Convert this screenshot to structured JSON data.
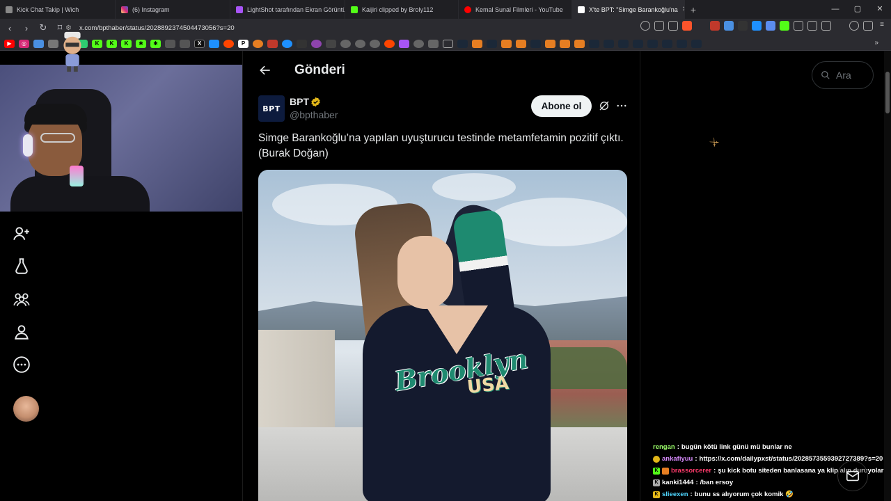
{
  "browser": {
    "tabs": [
      {
        "title": "Kick Chat Takip | Wich",
        "favicon_color": "#888888",
        "active": false
      },
      {
        "title": "(6) Instagram",
        "favicon_color": "#d6249f",
        "active": false
      },
      {
        "title": "LightShot tarafından Ekran Görüntüs",
        "favicon_color": "#a855f7",
        "active": false
      },
      {
        "title": "Kaijiri clipped by Broly112",
        "favicon_color": "#53fc18",
        "active": false
      },
      {
        "title": "Kemal Sunal Filmleri - YouTube",
        "favicon_color": "#ff0000",
        "active": false
      },
      {
        "title": "X'te BPT: \"Simge Barankoğlu'na",
        "favicon_color": "#ffffff",
        "active": true
      }
    ],
    "url": "x.com/bpthaber/status/2028892374504473056?s=20"
  },
  "page": {
    "title": "Gönderi",
    "search_placeholder": "Ara"
  },
  "tweet": {
    "author_name": "BPT",
    "author_handle": "@bpthaber",
    "avatar_text": "BPT",
    "subscribe_label": "Abone ol",
    "text": "Simge Barankoğlu’na yapılan uyuşturucu testinde metamfetamin pozitif çıktı. (Burak Doğan)",
    "image_logo_text": "Brooklyn",
    "image_logo_sub": "USA"
  },
  "colors": {
    "accent": "#1d9bf0",
    "verified": "#e2b719",
    "background": "#000000"
  },
  "chat": [
    {
      "user": "rengan",
      "user_color": "#9cff6b",
      "badge": "",
      "message": "bugün kötü link günü mü bunlar ne"
    },
    {
      "user": "ankafiyuu",
      "user_color": "#d98cff",
      "badge": "gold",
      "message": "https://x.com/dailypxst/status/2028573559392727389?s=20"
    },
    {
      "user": "brassorcerer",
      "user_color": "#ff3b6b",
      "badge": "kick",
      "message": "şu kick botu siteden banlasana ya klip alıp duruyolar"
    },
    {
      "user": "kanki1444",
      "user_color": "#ffffff",
      "badge": "k-gray",
      "message": "/ban ersoy"
    },
    {
      "user": "slieexen",
      "user_color": "#4fd6ff",
      "badge": "kick",
      "message": "bunu ss alıyorum çok komik 🤣"
    }
  ]
}
